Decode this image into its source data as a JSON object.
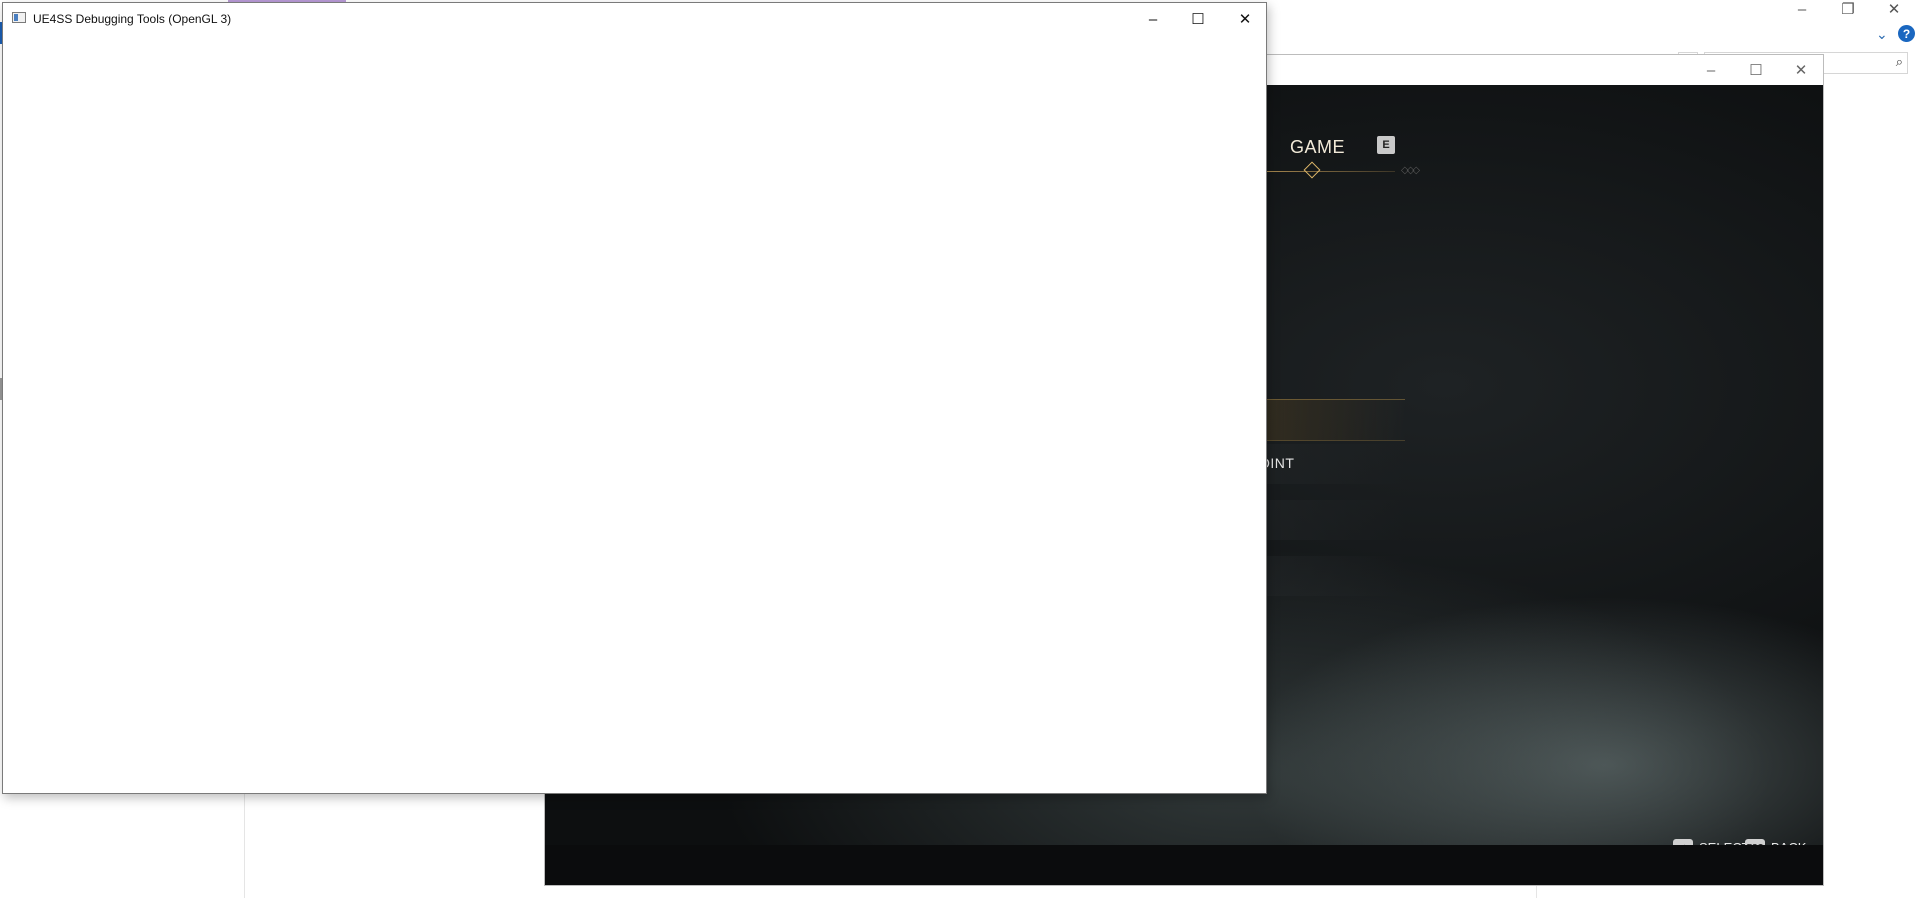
{
  "debugger_window": {
    "title": "UE4SS Debugging Tools (OpenGL 3)",
    "controls": {
      "minimize": "–",
      "maximize": "☐",
      "close": "✕"
    }
  },
  "game_window": {
    "controls": {
      "minimize": "–",
      "maximize": "☐",
      "close": "✕"
    },
    "menu": {
      "active_tab": "GAME",
      "tab_key": "E",
      "rows": [
        {
          "label": ""
        },
        {
          "label": "OINT"
        },
        {
          "label": ""
        },
        {
          "label": ""
        }
      ]
    },
    "hints": {
      "select_key": "↵",
      "select_label": "SELECT",
      "back_key": "ESC",
      "back_label": "BACK"
    }
  },
  "background_window": {
    "controls": {
      "minimize": "–",
      "restore": "❐",
      "close": "✕"
    },
    "help": "?",
    "chevron": "⌄",
    "search_icon": "⌕"
  }
}
